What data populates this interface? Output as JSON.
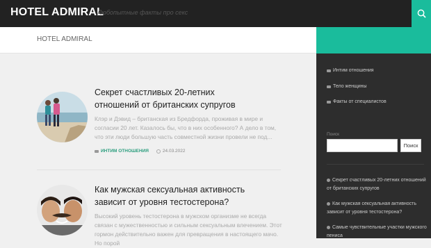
{
  "header": {
    "site_title": "HOTEL ADMIRAL",
    "tagline": "Любопытные факты про секс",
    "crumb": "HOTEL ADMIRAL"
  },
  "posts": [
    {
      "title": "Секрет счастливых 20-летних отношений от британских супругов",
      "excerpt": "Клэр и Дэвид – британская из Бредфорда, проживая в мире и согласии 20 лет. Казалось бы, что в них особенного? А дело в том, что эти люди большую часть совместной жизни провели не под...",
      "category": "ИНТИМ ОТНОШЕНИЯ",
      "date": "24.03.2022"
    },
    {
      "title": "Как мужская сексуальная активность зависит от уровня тестостерона?",
      "excerpt": "Высокий уровень тестостерона в мужском организме не всегда связан с мужественностью и сильным сексуальным влечением. Этот гормон действительно важен для превращения в настоящего мачо. Но порой"
    }
  ],
  "sidebar": {
    "categories": [
      "Интим отношения",
      "Тело женщины",
      "Факты от специалистов"
    ],
    "search_label": "Поиск",
    "search_button": "Поиск",
    "recent": [
      "Секрет счастливых 20-летних отношений от британских супругов",
      "Как мужская сексуальная активность зависит от уровня тестостерона?",
      "Самые чувствительные участки мужского пениса"
    ]
  },
  "colors": {
    "accent": "#1abc9c",
    "topbar": "#222222",
    "sidebar": "#2d2d2d"
  },
  "icons": [
    "search-icon",
    "folder-icon",
    "clock-icon",
    "bullet-icon"
  ]
}
